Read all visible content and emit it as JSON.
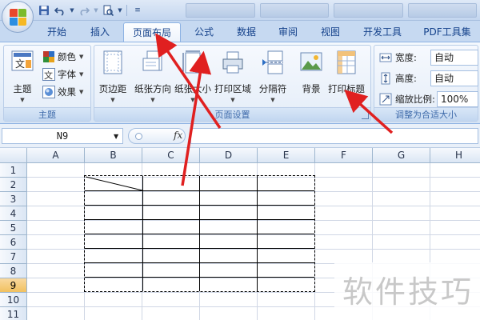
{
  "tabs": [
    "开始",
    "插入",
    "页面布局",
    "公式",
    "数据",
    "审阅",
    "视图",
    "开发工具",
    "PDF工具集"
  ],
  "active_tab": "页面布局",
  "ribbon": {
    "theme_group": {
      "label": "主题",
      "themes_button": "主题",
      "colors": "颜色",
      "fonts": "字体",
      "effects": "效果"
    },
    "page_setup_group": {
      "label": "页面设置",
      "buttons": [
        "页边距",
        "纸张方向",
        "纸张大小",
        "打印区域",
        "分隔符",
        "背景",
        "打印标题"
      ]
    },
    "scale_group": {
      "label": "调整为合适大小",
      "width_label": "宽度:",
      "width_value": "自动",
      "height_label": "高度:",
      "height_value": "自动",
      "scale_label": "缩放比例:",
      "scale_value": "100%"
    }
  },
  "formula_bar": {
    "name_box": "N9",
    "fx": "fx",
    "formula": ""
  },
  "grid": {
    "columns": [
      "A",
      "B",
      "C",
      "D",
      "E",
      "F",
      "G",
      "H"
    ],
    "rows": [
      "1",
      "2",
      "3",
      "4",
      "5",
      "6",
      "7",
      "8",
      "9",
      "10",
      "11"
    ],
    "active_row": "9"
  },
  "watermark": "软件技巧",
  "colors": {
    "ribbon_text": "#15428b",
    "annotation_arrow": "#e02020",
    "active_header": "#f1c15f"
  }
}
